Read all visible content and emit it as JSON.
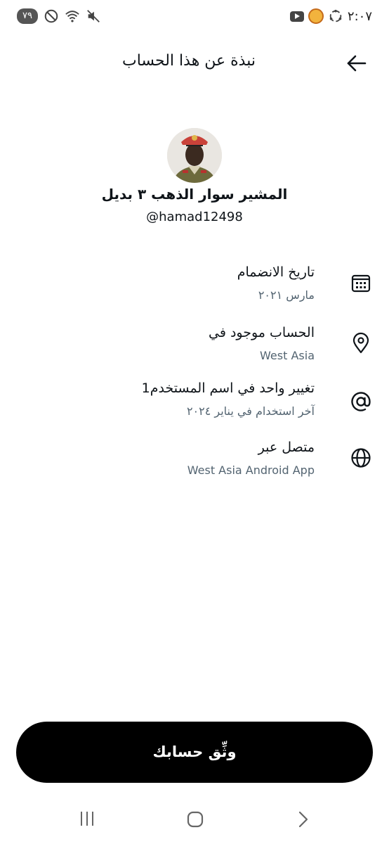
{
  "status_bar": {
    "time": "٢:٠٧",
    "battery": "٧٩",
    "icons": [
      "youtube-icon",
      "game-icon",
      "sync-icon",
      "mute-icon",
      "wifi-icon",
      "dnd-icon"
    ]
  },
  "header": {
    "title": "نبذة عن هذا الحساب",
    "back_icon": "arrow-right-icon"
  },
  "profile": {
    "display_name": "المشير سوار الذهب ٣ بديل",
    "handle": "@hamad12498"
  },
  "info": [
    {
      "icon": "calendar-icon",
      "title": "تاريخ الانضمام",
      "subtitle": "مارس ٢٠٢١"
    },
    {
      "icon": "location-icon",
      "title": "الحساب موجود في",
      "subtitle": "West Asia"
    },
    {
      "icon": "at-sign-icon",
      "title": "تغيير واحد في اسم المستخدم1",
      "subtitle": "آخر استخدام في يناير ٢٠٢٤"
    },
    {
      "icon": "globe-icon",
      "title": "متصل عبر",
      "subtitle": "West Asia Android App"
    }
  ],
  "verify_button": {
    "label": "وثِّق حسابك"
  },
  "nav_bar": {
    "icons": [
      "recent-apps-icon",
      "home-icon",
      "back-icon"
    ]
  },
  "colors": {
    "primary_text": "#0f1419",
    "secondary_text": "#536471",
    "button_bg": "#000000"
  }
}
